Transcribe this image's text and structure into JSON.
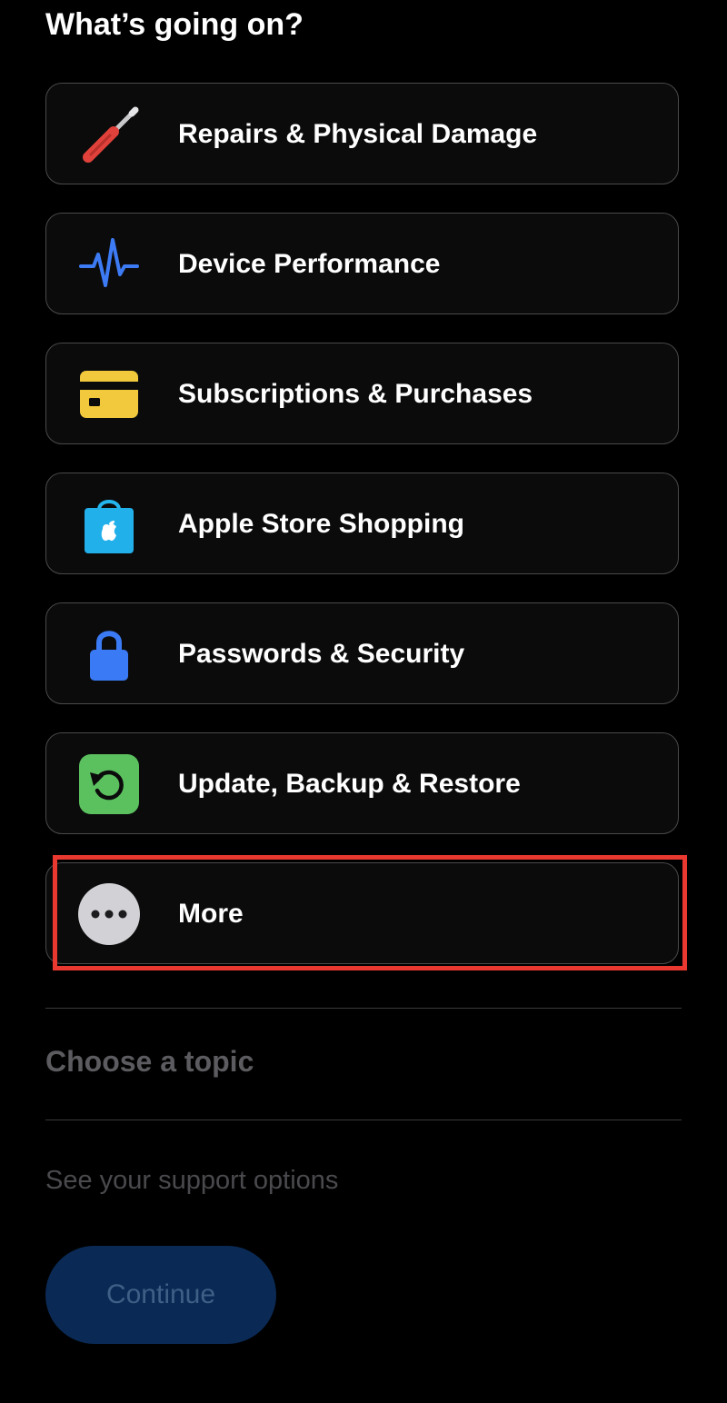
{
  "heading": "What’s going on?",
  "topics": [
    {
      "label": "Repairs & Physical Damage",
      "icon": "screwdriver-icon"
    },
    {
      "label": "Device Performance",
      "icon": "pulse-icon"
    },
    {
      "label": "Subscriptions & Purchases",
      "icon": "credit-card-icon"
    },
    {
      "label": "Apple Store Shopping",
      "icon": "shopping-bag-icon"
    },
    {
      "label": "Passwords & Security",
      "icon": "lock-icon"
    },
    {
      "label": "Update, Backup & Restore",
      "icon": "restore-icon"
    },
    {
      "label": "More",
      "icon": "more-icon"
    }
  ],
  "selected_topic": "More",
  "choose_topic_label": "Choose a topic",
  "support_options_label": "See your support options",
  "continue_label": "Continue",
  "colors": {
    "background": "#000000",
    "card_border": "#4a4a4c",
    "highlight": "#e8382f",
    "continue_bg": "#0a2a55",
    "muted_text": "#5c5c60"
  }
}
